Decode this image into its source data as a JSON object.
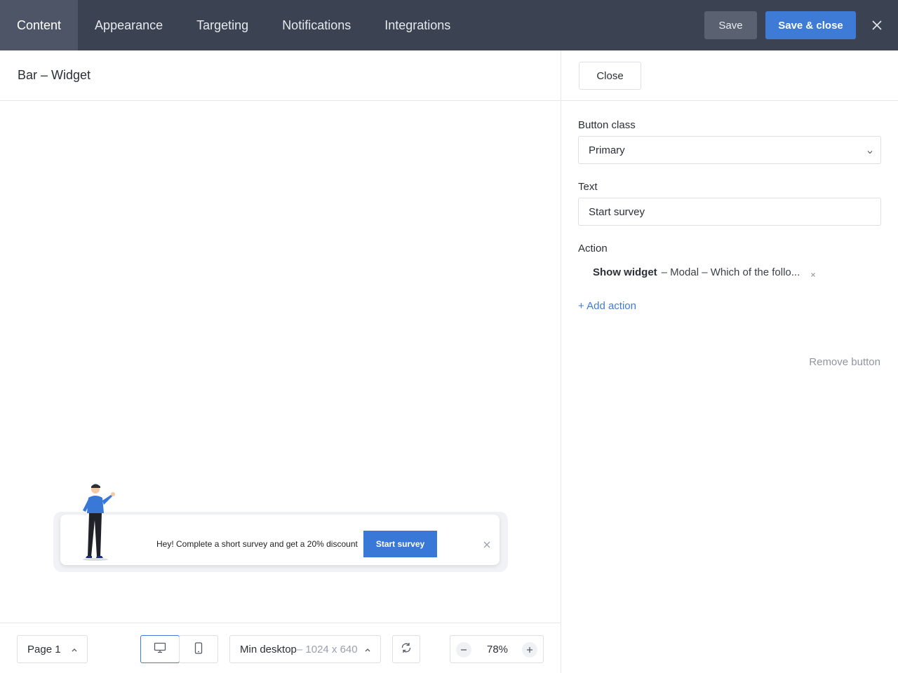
{
  "topbar": {
    "tabs": [
      {
        "label": "Content"
      },
      {
        "label": "Appearance"
      },
      {
        "label": "Targeting"
      },
      {
        "label": "Notifications"
      },
      {
        "label": "Integrations"
      }
    ],
    "active_tab": "Content",
    "save_label": "Save",
    "save_close_label": "Save & close",
    "close_icon": "close-icon"
  },
  "editor": {
    "title": "Bar – Widget"
  },
  "preview": {
    "message": "Hey! Complete a short survey and get a 20% discount",
    "button_label": "Start survey",
    "close_icon": "close-icon"
  },
  "bottom": {
    "page_label": "Page 1",
    "resolution_label": "Min desktop",
    "resolution_value": "– 1024 x 640",
    "zoom_value": "78%"
  },
  "panel": {
    "close_label": "Close",
    "button_class_label": "Button class",
    "button_class_value": "Primary",
    "text_label": "Text",
    "text_value": "Start survey",
    "action_label": "Action",
    "action_name": "Show widget",
    "action_detail": "– Modal – Which of the follo...",
    "add_action_label": "+ Add action",
    "remove_button_label": "Remove button"
  },
  "colors": {
    "topbar": "#3b4353",
    "accent": "#3e7bd6"
  }
}
